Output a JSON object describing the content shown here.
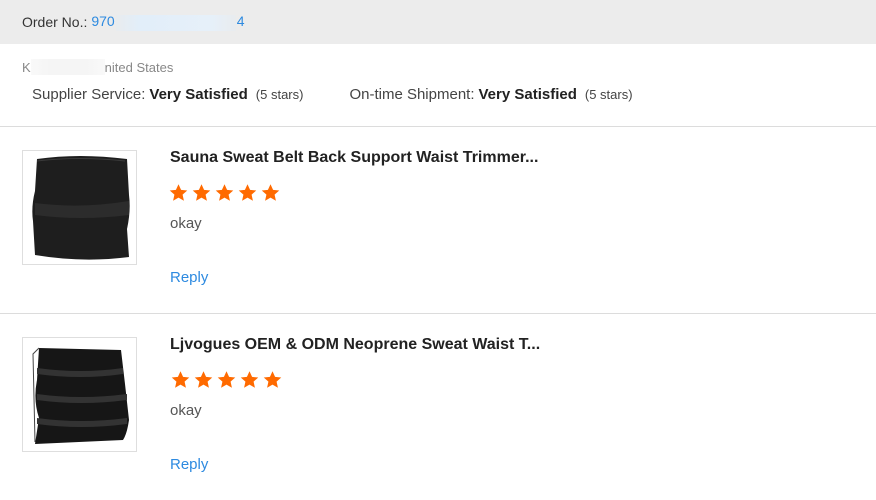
{
  "order": {
    "label": "Order No.:",
    "number_prefix": "970",
    "number_suffix": "4"
  },
  "buyer": {
    "name_prefix": "K",
    "location_suffix": "nited States"
  },
  "ratings": [
    {
      "label": "Supplier Service:",
      "value": "Very Satisfied",
      "note": "(5 stars)"
    },
    {
      "label": "On-time Shipment:",
      "value": "Very Satisfied",
      "note": "(5 stars)"
    }
  ],
  "reviews": [
    {
      "title": "Sauna Sweat Belt Back Support Waist Trimmer...",
      "stars": 5,
      "comment": "okay",
      "reply_label": "Reply",
      "image_icon": "waist-trimmer-belt-photo"
    },
    {
      "title": "Ljvogues OEM & ODM Neoprene Sweat Waist T...",
      "stars": 5,
      "comment": "okay",
      "reply_label": "Reply",
      "image_icon": "neoprene-waist-trainer-photo"
    }
  ],
  "colors": {
    "star": "#ff6a00",
    "link": "#2d8ae0",
    "header_bg": "#ececec"
  }
}
